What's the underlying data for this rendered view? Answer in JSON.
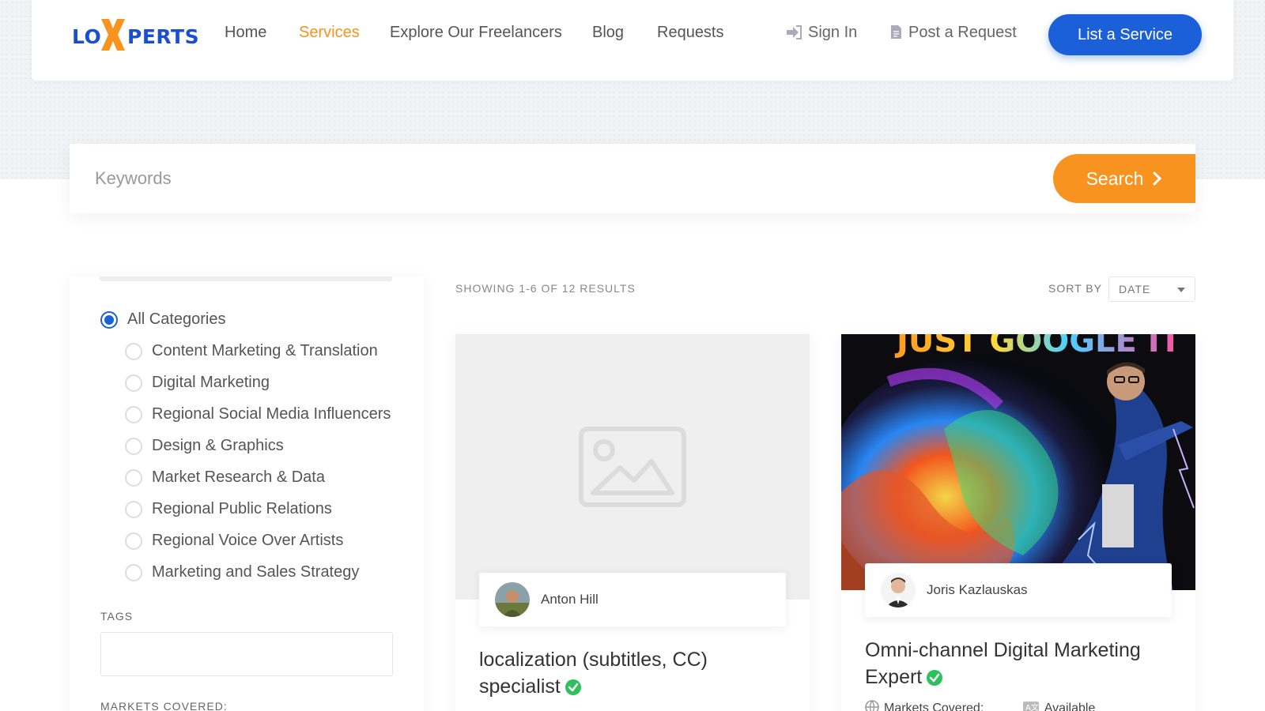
{
  "header": {
    "logo": {
      "part1": "LO",
      "part2": "PERTS"
    },
    "nav": [
      {
        "label": "Home",
        "active": false
      },
      {
        "label": "Services",
        "active": true
      },
      {
        "label": "Explore Our Freelancers",
        "active": false
      },
      {
        "label": "Blog",
        "active": false
      },
      {
        "label": "Requests",
        "active": false
      }
    ],
    "sign_in": "Sign In",
    "post_request": "Post a Request",
    "list_service": "List a Service"
  },
  "search": {
    "placeholder": "Keywords",
    "button": "Search"
  },
  "sidebar": {
    "categories": [
      {
        "label": "All Categories",
        "checked": true
      },
      {
        "label": "Content Marketing & Translation",
        "checked": false
      },
      {
        "label": "Digital Marketing",
        "checked": false
      },
      {
        "label": "Regional Social Media Influencers",
        "checked": false
      },
      {
        "label": "Design & Graphics",
        "checked": false
      },
      {
        "label": "Market Research & Data",
        "checked": false
      },
      {
        "label": "Regional Public Relations",
        "checked": false
      },
      {
        "label": "Regional Voice Over Artists",
        "checked": false
      },
      {
        "label": "Marketing and Sales Strategy",
        "checked": false
      }
    ],
    "tags_label": "TAGS",
    "markets_label": "MARKETS COVERED:"
  },
  "results": {
    "count": "SHOWING 1-6 OF 12 RESULTS",
    "sort_label": "SORT BY",
    "sort_value": "DATE"
  },
  "cards": [
    {
      "author": "Anton Hill",
      "title_line1": "localization (subtitles, CC)",
      "title_line2": "specialist"
    },
    {
      "author": "Joris Kazlauskas",
      "title_line1": "Omni-channel Digital Marketing",
      "title_line2": "Expert",
      "meta_markets": "Markets Covered:",
      "meta_available": "Available",
      "art_text": "JUST GOOGLE IT"
    }
  ],
  "colors": {
    "brand_blue": "#1b5fd9",
    "accent_orange": "#f7931e",
    "verified_green": "#2ec05c"
  }
}
